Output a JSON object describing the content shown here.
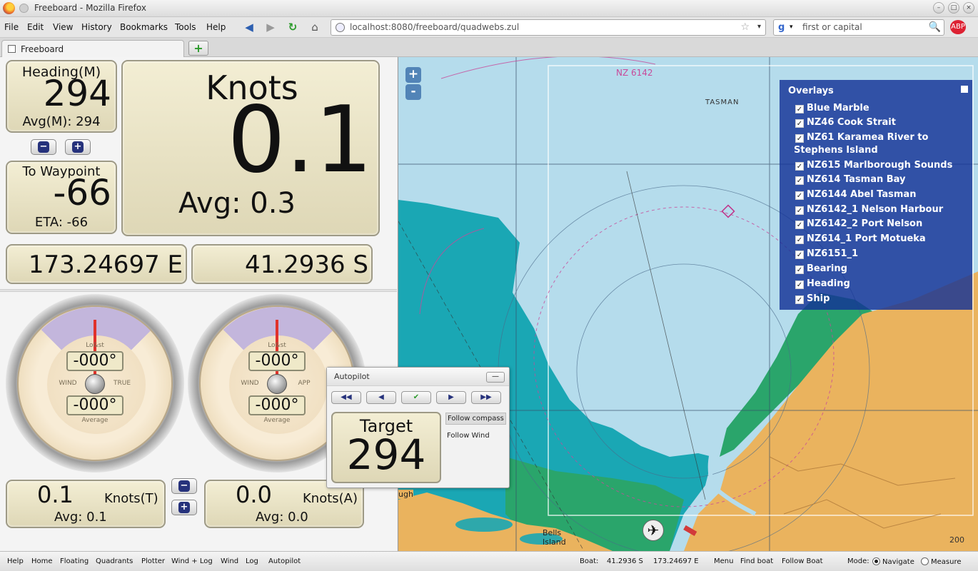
{
  "window": {
    "title": "Freeboard - Mozilla Firefox",
    "min_glyph": "–",
    "max_glyph": "□",
    "close_glyph": "×"
  },
  "menubar": {
    "items": [
      "File",
      "Edit",
      "View",
      "History",
      "Bookmarks",
      "Tools",
      "Help"
    ],
    "back_glyph": "◀",
    "forward_glyph": "▶",
    "reload_glyph": "↻",
    "home_glyph": "⌂",
    "url": "localhost:8080/freeboard/quadwebs.zul",
    "star_glyph": "☆",
    "dropdown_glyph": "▾",
    "search_engine_glyph": "g",
    "search_query": "first or capital",
    "search_glyph": "🔍",
    "addon_label": "ABP"
  },
  "tabs": [
    {
      "label": "Freeboard"
    }
  ],
  "new_tab_glyph": "+",
  "instruments": {
    "heading": {
      "label": "Heading(M)",
      "value": "294",
      "avg": "Avg(M): 294"
    },
    "knots": {
      "label": "Knots",
      "value": "0.1",
      "avg": "Avg: 0.3"
    },
    "waypoint": {
      "label": "To Waypoint",
      "value": "-66",
      "eta": "ETA: -66"
    },
    "minus_glyph": "−",
    "plus_glyph": "+",
    "longitude": "173.24697 E",
    "latitude": "41.2936 S"
  },
  "gauges": [
    {
      "top_label": "Lo&st",
      "value": "-000°",
      "left": "WIND",
      "right": "TRUE",
      "average": "-000°",
      "average_label": "Average"
    },
    {
      "top_label": "Lo&st",
      "value": "-000°",
      "left": "WIND",
      "right": "APP",
      "average": "-000°",
      "average_label": "Average"
    }
  ],
  "wind": {
    "true": {
      "value": "0.1",
      "unit": "Knots(T)",
      "avg": "Avg: 0.1"
    },
    "apparent": {
      "value": "0.0",
      "unit": "Knots(A)",
      "avg": "Avg: 0.0"
    }
  },
  "map": {
    "chart_label": "NZ 6142",
    "place_label": "TASMAN",
    "island_label": "Bells Island",
    "corner_label": "ugh",
    "depth_label": "200",
    "zoom_in": "+",
    "zoom_out": "-",
    "plane_glyph": "✈"
  },
  "overlays": {
    "title": "Overlays",
    "check_glyph": "✓",
    "items": [
      {
        "label": "Blue Marble",
        "checked": true
      },
      {
        "label": "NZ46 Cook Strait",
        "checked": true
      },
      {
        "label": "NZ61 Karamea River to",
        "checked": true
      },
      {
        "label": "Stephens Island",
        "checked": null
      },
      {
        "label": "NZ615 Marlborough Sounds",
        "checked": true
      },
      {
        "label": "NZ614 Tasman Bay",
        "checked": true
      },
      {
        "label": "NZ6144 Abel Tasman",
        "checked": true
      },
      {
        "label": "NZ6142_1 Nelson Harbour",
        "checked": true
      },
      {
        "label": "NZ6142_2 Port Nelson",
        "checked": true
      },
      {
        "label": "NZ614_1 Port Motueka",
        "checked": true
      },
      {
        "label": "NZ6151_1",
        "checked": true
      },
      {
        "label": "Bearing",
        "checked": true
      },
      {
        "label": "Heading",
        "checked": true
      },
      {
        "label": "Ship",
        "checked": true
      }
    ]
  },
  "autopilot": {
    "title": "Autopilot",
    "minimize": "—",
    "buttons": [
      "◀◀",
      "◀",
      "✔",
      "▶",
      "▶▶"
    ],
    "target_label": "Target",
    "target_value": "294",
    "options": [
      "Follow compass",
      "Follow Wind"
    ]
  },
  "statusbar": {
    "left": [
      "Help",
      "Home",
      "Floating",
      "Quadrants",
      "Plotter",
      "Wind + Log",
      "Wind",
      "Log",
      "Autopilot"
    ],
    "boat_label": "Boat:",
    "boat_lat": "41.2936 S",
    "boat_lon": "173.24697 E",
    "menu": "Menu",
    "find_boat": "Find boat",
    "follow_boat": "Follow Boat",
    "mode_label": "Mode:",
    "mode_navigate": "Navigate",
    "mode_measure": "Measure"
  },
  "colors": {
    "sea_deep": "#b5dcec",
    "sea_teal": "#1aa7b4",
    "shallow_green": "#2aa56b",
    "land": "#eab35e",
    "overlay_panel": "#1f3a9a",
    "instrument_panel": "#e9e3c4"
  }
}
